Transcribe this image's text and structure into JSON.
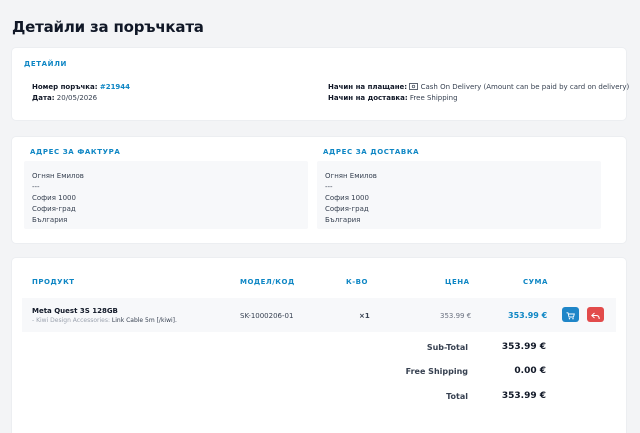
{
  "page": {
    "title": "Детайли за поръчката"
  },
  "details": {
    "section_title": "ДЕТАЙЛИ",
    "order_label": "Номер поръчка:",
    "order_number": "#21944",
    "date_label": "Дата:",
    "date_value": "20/05/2026",
    "payment_label": "Начин на плащане:",
    "payment_value": "Cash On Delivery (Amount can be paid by card on delivery)",
    "shipping_label": "Начин на доставка:",
    "shipping_value": "Free Shipping"
  },
  "billing": {
    "title": "АДРЕС ЗА ФАКТУРА",
    "lines": [
      "Огнян Емилов",
      "---",
      "София 1000",
      "София-град",
      "България"
    ]
  },
  "delivery": {
    "title": "АДРЕС ЗА ДОСТАВКА",
    "lines": [
      "Огнян Емилов",
      "---",
      "София 1000",
      "София-град",
      "България"
    ]
  },
  "table": {
    "headers": {
      "product": "ПРОДУКТ",
      "model": "МОДЕЛ/КОД",
      "qty": "К-ВО",
      "price": "ЦЕНА",
      "sum": "СУМА"
    },
    "rows": [
      {
        "name": "Meta Quest 3S 128GB",
        "option_label": "- Kiwi Design Accessories:",
        "option_value": "Link Cable 5m [/kiwi].",
        "model": "SK-1000206-01",
        "qty": "×1",
        "price": "353.99 €",
        "sum": "353.99 €"
      }
    ]
  },
  "totals": {
    "subtotal_label": "Sub-Total",
    "subtotal_value": "353.99 €",
    "shipping_label": "Free Shipping",
    "shipping_value": "0.00 €",
    "total_label": "Total",
    "total_value": "353.99 €"
  },
  "colors": {
    "accent": "#0e86c4",
    "cart_button": "#1f86c8",
    "return_button": "#e24b4b"
  },
  "icons": {
    "cart": "shopping-cart-icon",
    "return": "reply-icon",
    "payment": "cash-icon"
  }
}
